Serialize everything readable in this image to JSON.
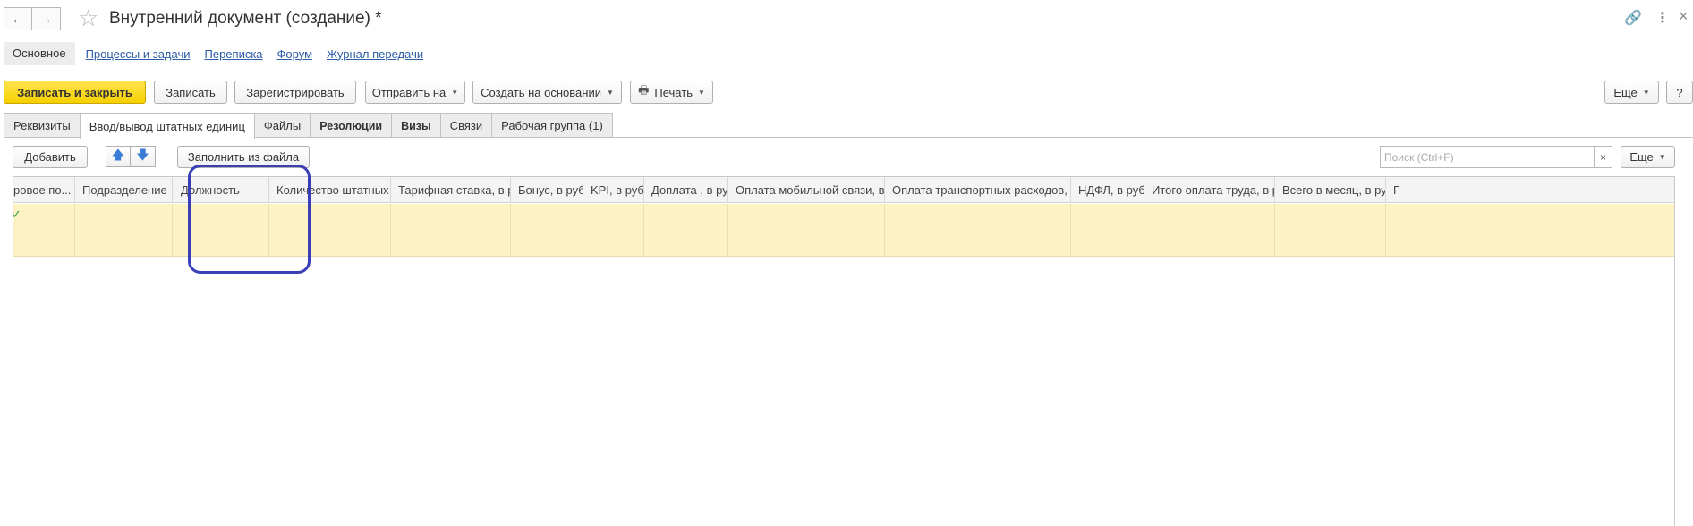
{
  "window": {
    "title": "Внутренний документ (создание) *",
    "back_icon": "←",
    "forward_icon": "→",
    "star_icon": "☆",
    "link_icon": "🔗",
    "more_icon": "⋮",
    "close_icon": "×"
  },
  "section_nav": {
    "active": "Основное",
    "links": [
      "Процессы и задачи",
      "Переписка",
      "Форум",
      "Журнал передачи"
    ]
  },
  "toolbar": {
    "save_close": "Записать и закрыть",
    "save": "Записать",
    "register": "Зарегистрировать",
    "send_to": "Отправить на",
    "create_based": "Создать на основании",
    "print": "Печать",
    "more": "Еще",
    "help": "?"
  },
  "tabs": [
    "Реквизиты",
    "Ввод/вывод штатных единиц",
    "Файлы",
    "Резолюции",
    "Визы",
    "Связи",
    "Рабочая группа (1)"
  ],
  "table_toolbar": {
    "add": "Добавить",
    "up_icon": "🡅",
    "down_icon": "🡇",
    "fill_from_file": "Заполнить из файла",
    "search_placeholder": "Поиск (Ctrl+F)",
    "search_clear": "×",
    "more": "Еще"
  },
  "grid": {
    "columns": [
      "ровое по...",
      "Подразделение",
      "Должность",
      "Количество штатных ед.",
      "Тарифная ставка, в руб.",
      "Бонус, в руб.",
      "KPI, в руб.",
      "Доплата , в руб.",
      "Оплата мобильной связи, в руб.",
      "Оплата транспортных расходов, в руб.",
      "НДФЛ, в руб.",
      "Итого оплата труда, в руб.",
      "Всего в месяц, в руб.",
      "Г"
    ],
    "row_check": "✓"
  },
  "colors": {
    "primary_button": "#f5d000",
    "link": "#2b5ca6",
    "row_selected": "#fdf2c4",
    "highlight": "#3b3fb5"
  }
}
